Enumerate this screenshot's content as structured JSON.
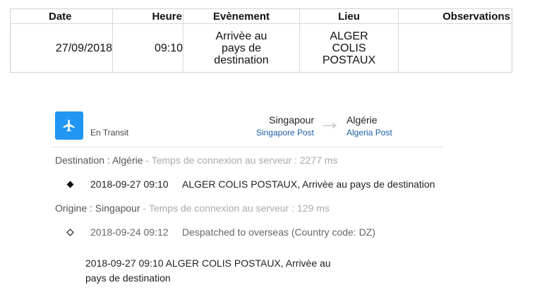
{
  "table": {
    "headers": {
      "date": "Date",
      "heure": "Heure",
      "event": "Evènement",
      "lieu": "Lieu",
      "observations": "Observations"
    },
    "rows": [
      {
        "date": "27/09/2018",
        "heure": "09:10",
        "event": "Arrivèe au pays de destination",
        "lieu": "ALGER COLIS POSTAUX",
        "observations": ""
      }
    ]
  },
  "tracking": {
    "status": {
      "label": "En Transit",
      "icon": "airplane-icon",
      "color": "#2196f3"
    },
    "origin": {
      "country": "Singapour",
      "carrier": "Singapore Post"
    },
    "destination": {
      "country": "Algérie",
      "carrier": "Algeria Post"
    },
    "destination_section": {
      "title": "Destination : Algérie",
      "meta": " - Temps de connexion au serveur : 2277 ms",
      "events": [
        {
          "datetime": "2018-09-27 09:10",
          "description": "ALGER COLIS POSTAUX, Arrivèe au pays de destination",
          "marker": "filled-diamond"
        }
      ]
    },
    "origin_section": {
      "title": "Origine : Singapour",
      "meta": " - Temps de connexion au serveur : 129 ms",
      "events": [
        {
          "datetime": "2018-09-24 09:12",
          "description": "Despatched to overseas (Country code: DZ)",
          "marker": "hollow-diamond"
        }
      ]
    },
    "summary": "2018-09-27 09:10  ALGER COLIS POSTAUX, Arrivèe au pays de destination"
  }
}
